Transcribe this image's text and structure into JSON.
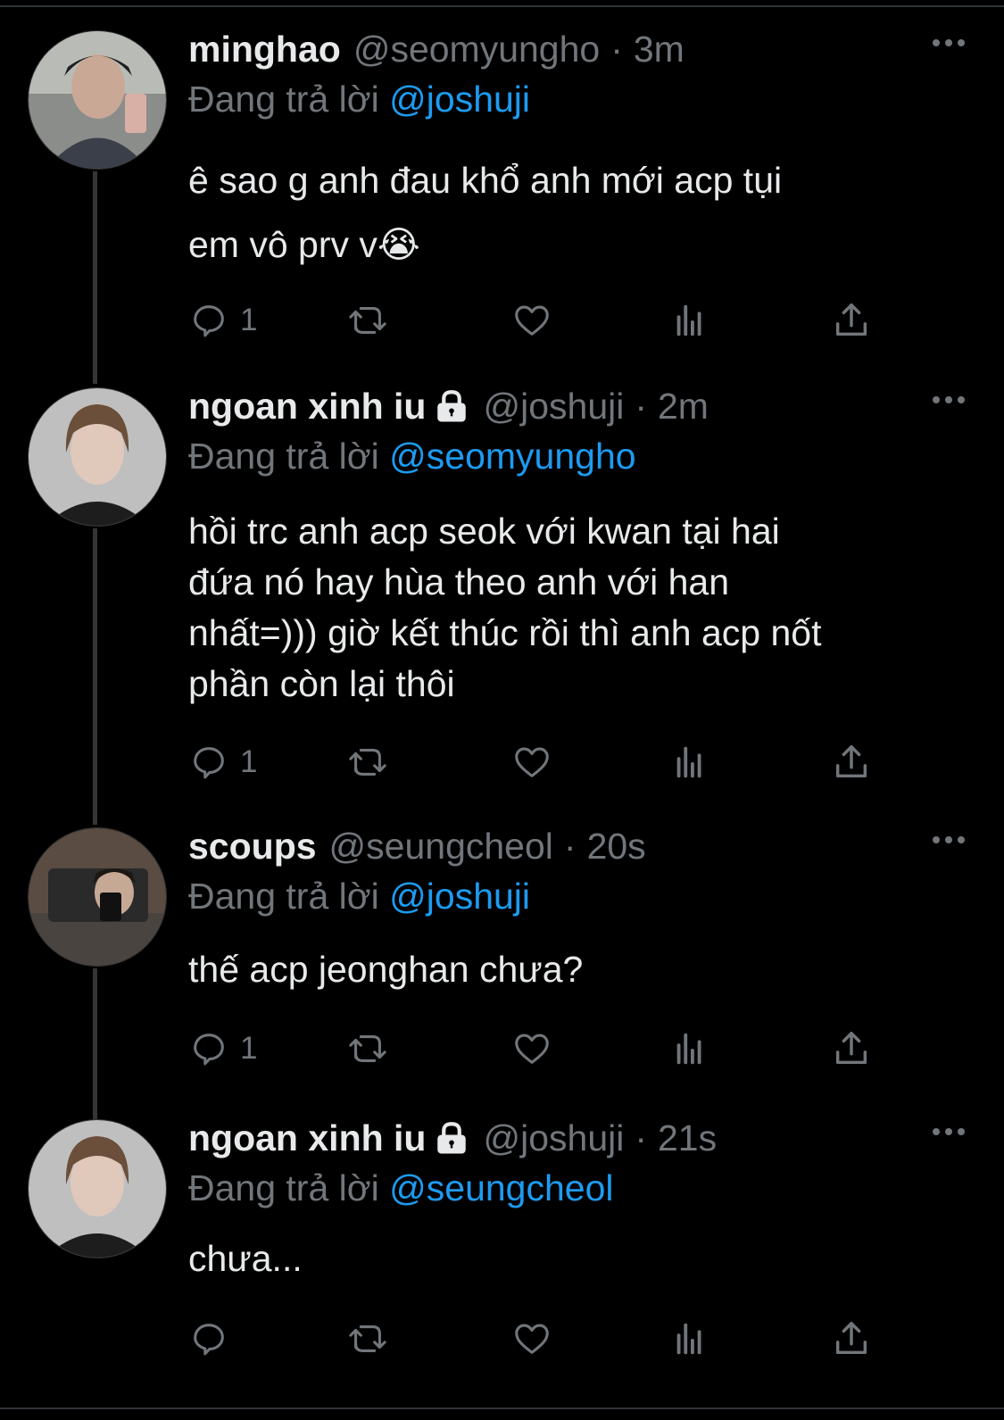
{
  "thread": [
    {
      "name": "minghao",
      "locked": false,
      "handle": "@seomyungho",
      "separator": "·",
      "time": "3m",
      "replying_prefix": "Đang trả lời",
      "replying_to": "@joshuji",
      "text_lines": [
        "ê sao g anh đau khổ anh mới acp tụi",
        "em vô prv v😭"
      ],
      "reply_count": "1",
      "avatar_icon": "avatar-photo"
    },
    {
      "name": "ngoan xinh iu",
      "locked": true,
      "handle": "@joshuji",
      "separator": "·",
      "time": "2m",
      "replying_prefix": "Đang trả lời",
      "replying_to": "@seomyungho",
      "text_lines": [
        "hồi trc anh acp seok với kwan tại hai",
        "đứa nó hay hùa theo anh với han",
        "nhất=))) giờ kết thúc rồi thì anh acp nốt",
        "phần còn lại thôi"
      ],
      "reply_count": "1",
      "avatar_icon": "avatar-photo"
    },
    {
      "name": "scoups",
      "locked": false,
      "handle": "@seungcheol",
      "separator": "·",
      "time": "20s",
      "replying_prefix": "Đang trả lời",
      "replying_to": "@joshuji",
      "text_lines": [
        "thế acp jeonghan chưa?"
      ],
      "reply_count": "1",
      "avatar_icon": "avatar-photo"
    },
    {
      "name": "ngoan xinh iu",
      "locked": true,
      "handle": "@joshuji",
      "separator": "·",
      "time": "21s",
      "replying_prefix": "Đang trả lời",
      "replying_to": "@seungcheol",
      "text_lines": [
        "chưa..."
      ],
      "reply_count": "",
      "avatar_icon": "avatar-photo"
    }
  ],
  "icons": {
    "reply": "reply-icon",
    "retweet": "retweet-icon",
    "like": "heart-icon",
    "views": "views-icon",
    "share": "share-icon",
    "more": "more-dots-icon",
    "lock": "lock-icon"
  },
  "colors": {
    "background": "#000000",
    "text": "#e7e9ea",
    "muted": "#71767b",
    "mention": "#1d9bf0",
    "thread_line": "#333639"
  }
}
